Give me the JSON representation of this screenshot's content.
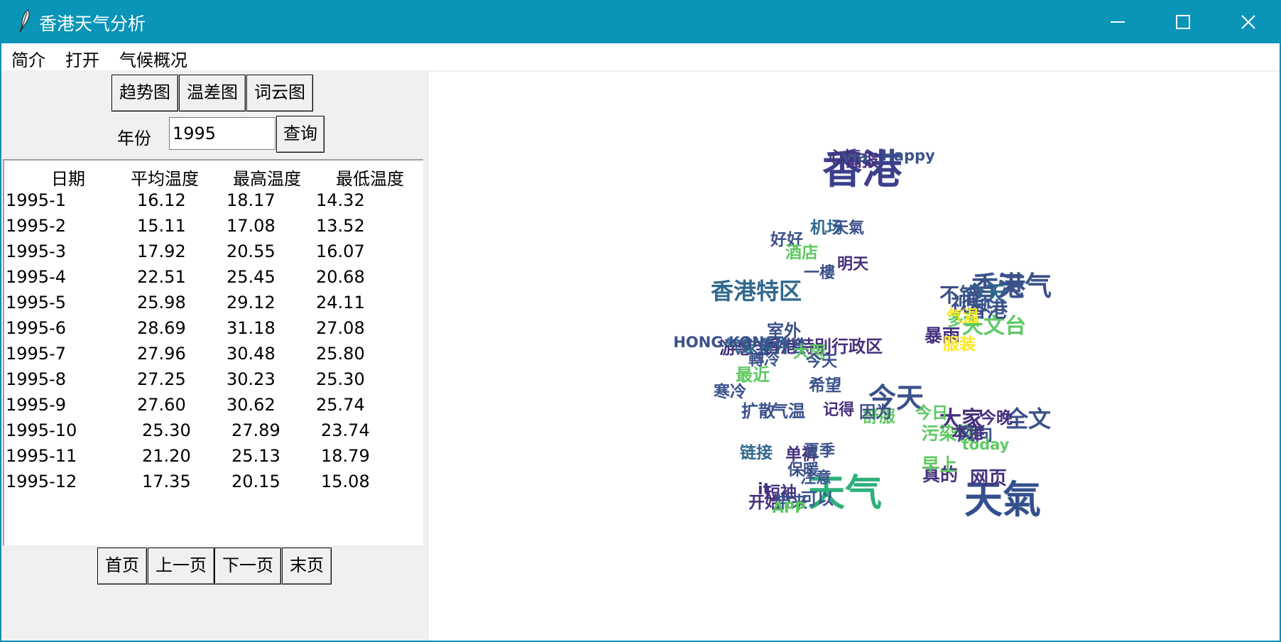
{
  "window": {
    "title": "香港天气分析"
  },
  "menu": {
    "items": [
      "简介",
      "打开",
      "气候概况"
    ]
  },
  "toolbar": {
    "trend": "趋势图",
    "diff": "温差图",
    "cloud": "词云图"
  },
  "query": {
    "year_label": "年份",
    "year_value": "1995",
    "button": "查询"
  },
  "table": {
    "headers": [
      "日期",
      "平均温度",
      "最高温度",
      "最低温度"
    ],
    "rows": [
      [
        "1995-1",
        "16.12",
        "18.17",
        "14.32"
      ],
      [
        "1995-2",
        "15.11",
        "17.08",
        "13.52"
      ],
      [
        "1995-3",
        "17.92",
        "20.55",
        "16.07"
      ],
      [
        "1995-4",
        "22.51",
        "25.45",
        "20.68"
      ],
      [
        "1995-5",
        "25.98",
        "29.12",
        "24.11"
      ],
      [
        "1995-6",
        "28.69",
        "31.18",
        "27.08"
      ],
      [
        "1995-7",
        "27.96",
        "30.48",
        "25.80"
      ],
      [
        "1995-8",
        "27.25",
        "30.23",
        "25.30"
      ],
      [
        "1995-9",
        "27.60",
        "30.62",
        "25.74"
      ],
      [
        "1995-10",
        "25.30",
        "27.89",
        "23.74"
      ],
      [
        "1995-11",
        "21.20",
        "25.13",
        "18.79"
      ],
      [
        "1995-12",
        "17.35",
        "20.15",
        "15.08"
      ]
    ]
  },
  "pager": {
    "first": "首页",
    "prev": "上一页",
    "next": "下一页",
    "last": "末页"
  },
  "wordcloud": {
    "words": [
      {
        "text": "香港",
        "weight": 1.0,
        "color": "#3b3f8c"
      },
      {
        "text": "天氣",
        "weight": 0.95,
        "color": "#34508c"
      },
      {
        "text": "天气",
        "weight": 0.9,
        "color": "#2db07a"
      },
      {
        "text": "今天",
        "weight": 0.62,
        "color": "#3b528b"
      },
      {
        "text": "天气",
        "weight": 0.6,
        "color": "#3b528b"
      },
      {
        "text": "香港",
        "weight": 0.58,
        "color": "#3b528b"
      },
      {
        "text": "香港特区",
        "weight": 0.45,
        "color": "#31688e"
      },
      {
        "text": "全文",
        "weight": 0.45,
        "color": "#3b528b"
      },
      {
        "text": "大家",
        "weight": 0.44,
        "color": "#46317e"
      },
      {
        "text": "天文台",
        "weight": 0.4,
        "color": "#5ec962"
      },
      {
        "text": "今天",
        "weight": 0.38,
        "color": "#31688e"
      },
      {
        "text": "香港",
        "weight": 0.38,
        "color": "#3b528b"
      },
      {
        "text": "不错",
        "weight": 0.37,
        "color": "#3b528b"
      },
      {
        "text": "视频",
        "weight": 0.36,
        "color": "#3b528b"
      },
      {
        "text": "网页",
        "weight": 0.32,
        "color": "#46317e"
      },
      {
        "text": "暴雨",
        "weight": 0.3,
        "color": "#46317e"
      },
      {
        "text": "真的",
        "weight": 0.3,
        "color": "#46317e"
      },
      {
        "text": "早上",
        "weight": 0.3,
        "color": "#5ec962"
      },
      {
        "text": "污染物",
        "weight": 0.3,
        "color": "#5ec962"
      },
      {
        "text": "风向",
        "weight": 0.3,
        "color": "#3b528b"
      },
      {
        "text": "香港特别行政区",
        "weight": 0.28,
        "color": "#46317e"
      },
      {
        "text": "游惠宝",
        "weight": 0.28,
        "color": "#46317e"
      },
      {
        "text": "最近",
        "weight": 0.28,
        "color": "#5ec962"
      },
      {
        "text": "气象条件",
        "weight": 0.27,
        "color": "#31688e"
      },
      {
        "text": "外套",
        "weight": 0.27,
        "color": "#3b528b"
      },
      {
        "text": "室外",
        "weight": 0.27,
        "color": "#3b528b"
      },
      {
        "text": "扩散",
        "weight": 0.27,
        "color": "#3b528b"
      },
      {
        "text": "气温",
        "weight": 0.27,
        "color": "#3b528b"
      },
      {
        "text": "舒服",
        "weight": 0.26,
        "color": "#5ec962"
      },
      {
        "text": "因为",
        "weight": 0.26,
        "color": "#3b528b"
      },
      {
        "text": "链接",
        "weight": 0.26,
        "color": "#31688e"
      },
      {
        "text": "单裤",
        "weight": 0.26,
        "color": "#46317e"
      },
      {
        "text": "短袖",
        "weight": 0.26,
        "color": "#46317e"
      },
      {
        "text": "开始",
        "weight": 0.26,
        "color": "#46317e"
      },
      {
        "text": "带来",
        "weight": 0.26,
        "color": "#3b528b"
      },
      {
        "text": "可以",
        "weight": 0.26,
        "color": "#3b528b"
      },
      {
        "text": "好好",
        "weight": 0.26,
        "color": "#3b528b"
      },
      {
        "text": "机场",
        "weight": 0.26,
        "color": "#31688e"
      },
      {
        "text": "心情",
        "weight": 0.26,
        "color": "#46317e"
      },
      {
        "text": "播报",
        "weight": 0.25,
        "color": "#46317e"
      },
      {
        "text": "酒店",
        "weight": 0.25,
        "color": "#5ec962"
      },
      {
        "text": "大雨",
        "weight": 0.24,
        "color": "#5ec962"
      },
      {
        "text": "希望",
        "weight": 0.24,
        "color": "#3b528b"
      },
      {
        "text": "寒冷",
        "weight": 0.24,
        "color": "#3b528b"
      },
      {
        "text": "多云",
        "weight": 0.24,
        "color": "#5ec962"
      },
      {
        "text": "服装",
        "weight": 0.24,
        "color": "#fde725"
      },
      {
        "text": "气温",
        "weight": 0.24,
        "color": "#fde725"
      },
      {
        "text": "本港",
        "weight": 0.24,
        "color": "#46317e"
      },
      {
        "text": "今晚",
        "weight": 0.24,
        "color": "#46317e"
      },
      {
        "text": "今日",
        "weight": 0.24,
        "color": "#5ec962"
      },
      {
        "text": "夏季",
        "weight": 0.23,
        "color": "#3b528b"
      },
      {
        "text": "保暖",
        "weight": 0.23,
        "color": "#3b528b"
      },
      {
        "text": "注意",
        "weight": 0.23,
        "color": "#3b528b"
      },
      {
        "text": "it",
        "weight": 0.23,
        "color": "#46317e"
      },
      {
        "text": "via",
        "weight": 0.22,
        "color": "#3b528b"
      },
      {
        "text": "天氣",
        "weight": 0.22,
        "color": "#3b528b"
      },
      {
        "text": "轉冷",
        "weight": 0.22,
        "color": "#3b528b"
      },
      {
        "text": "今天",
        "weight": 0.22,
        "color": "#3b528b"
      },
      {
        "text": "明天",
        "weight": 0.22,
        "color": "#46317e"
      },
      {
        "text": "一樓",
        "weight": 0.22,
        "color": "#3b528b"
      },
      {
        "text": "记得",
        "weight": 0.22,
        "color": "#46317e"
      },
      {
        "text": "Happy",
        "weight": 0.2,
        "color": "#3b528b"
      },
      {
        "text": "HONG KONG",
        "weight": 0.2,
        "color": "#3b528b"
      },
      {
        "text": "today",
        "weight": 0.2,
        "color": "#5ec962"
      },
      {
        "text": "APP",
        "weight": 0.2,
        "color": "#5ec962"
      }
    ]
  }
}
